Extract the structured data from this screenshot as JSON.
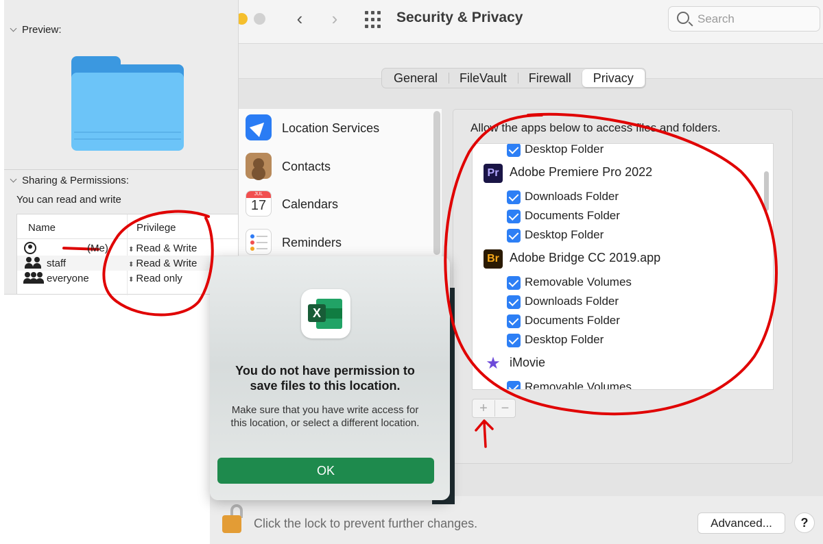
{
  "prefs": {
    "title": "Security & Privacy",
    "search_placeholder": "Search",
    "tabs": [
      {
        "label": "General"
      },
      {
        "label": "FileVault"
      },
      {
        "label": "Firewall"
      },
      {
        "label": "Privacy"
      }
    ],
    "active_tab": "Privacy",
    "services": [
      {
        "label": "Location Services",
        "icon": "location-arrow-icon"
      },
      {
        "label": "Contacts",
        "icon": "contacts-icon"
      },
      {
        "label": "Calendars",
        "icon": "calendar-icon",
        "icon_month": "JUL",
        "icon_day": "17"
      },
      {
        "label": "Reminders",
        "icon": "reminders-icon"
      }
    ],
    "files_description": "Allow the apps below to access files and folders.",
    "file_access": [
      {
        "type": "folder",
        "label": "Desktop Folder",
        "checked": true
      },
      {
        "type": "app",
        "label": "Adobe Premiere Pro 2022",
        "icon_text": "Pr"
      },
      {
        "type": "folder",
        "label": "Downloads Folder",
        "checked": true
      },
      {
        "type": "folder",
        "label": "Documents Folder",
        "checked": true
      },
      {
        "type": "folder",
        "label": "Desktop Folder",
        "checked": true
      },
      {
        "type": "app",
        "label": "Adobe Bridge CC 2019.app",
        "icon_text": "Br"
      },
      {
        "type": "folder",
        "label": "Removable Volumes",
        "checked": true
      },
      {
        "type": "folder",
        "label": "Downloads Folder",
        "checked": true
      },
      {
        "type": "folder",
        "label": "Documents Folder",
        "checked": true
      },
      {
        "type": "folder",
        "label": "Desktop Folder",
        "checked": true
      },
      {
        "type": "app",
        "label": "iMovie",
        "icon_text": "★"
      },
      {
        "type": "folder",
        "label": "Removable Volumes",
        "checked": true
      }
    ],
    "add_label": "+",
    "remove_label": "−",
    "footer_text": "Click the lock to prevent further changes.",
    "advanced_label": "Advanced...",
    "help_label": "?"
  },
  "info": {
    "preview_label": "Preview:",
    "sharing_label": "Sharing & Permissions:",
    "permission_note": "You can read and write",
    "columns": {
      "name": "Name",
      "privilege": "Privilege"
    },
    "rows": [
      {
        "name": "(Me)",
        "privilege": "Read & Write",
        "icon": "user-icon"
      },
      {
        "name": "staff",
        "privilege": "Read & Write",
        "icon": "group-icon"
      },
      {
        "name": "everyone",
        "privilege": "Read only",
        "icon": "everyone-icon"
      }
    ]
  },
  "alert": {
    "app_icon": "excel-icon",
    "icon_letter": "X",
    "title": "You do not have permission to save files to this location.",
    "body": "Make sure that you have write access for this location, or select a different location.",
    "ok_label": "OK"
  },
  "colors": {
    "accent": "#2d7ff5",
    "annotation_red": "#e00000",
    "excel_green": "#1e8a4d"
  }
}
